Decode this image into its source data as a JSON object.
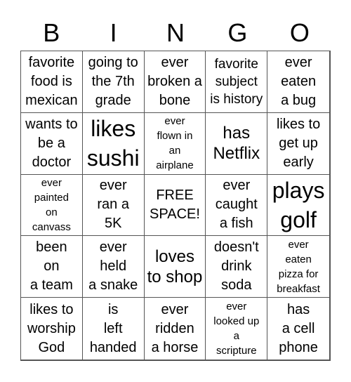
{
  "header": {
    "letters": [
      "B",
      "I",
      "N",
      "G",
      "O"
    ]
  },
  "cells": [
    {
      "text": "favorite\nfood is\nmexican",
      "size": "m"
    },
    {
      "text": "going to\nthe 7th\ngrade",
      "size": "m"
    },
    {
      "text": "ever\nbroken a\nbone",
      "size": "m"
    },
    {
      "text": "favorite\nsubject\nis history",
      "size": "ms"
    },
    {
      "text": "ever\neaten\na bug",
      "size": "m"
    },
    {
      "text": "wants to\nbe a\ndoctor",
      "size": "m"
    },
    {
      "text": "likes\nsushi",
      "size": "xl"
    },
    {
      "text": "ever\nflown in\nan\nairplane",
      "size": "s"
    },
    {
      "text": "has\nNetflix",
      "size": "l"
    },
    {
      "text": "likes to\nget up\nearly",
      "size": "m"
    },
    {
      "text": "ever\npainted\non\ncanvass",
      "size": "s"
    },
    {
      "text": "ever\nran a\n5K",
      "size": "m"
    },
    {
      "text": "FREE\nSPACE!",
      "size": "m",
      "free": true
    },
    {
      "text": "ever\ncaught\na fish",
      "size": "m"
    },
    {
      "text": "plays\ngolf",
      "size": "xl"
    },
    {
      "text": "been\non\na team",
      "size": "m"
    },
    {
      "text": "ever\nheld\na snake",
      "size": "m"
    },
    {
      "text": "loves\nto shop",
      "size": "l"
    },
    {
      "text": "doesn't\ndrink\nsoda",
      "size": "m"
    },
    {
      "text": "ever\neaten\npizza for\nbreakfast",
      "size": "s"
    },
    {
      "text": "likes to\nworship\nGod",
      "size": "m"
    },
    {
      "text": "is\nleft\nhanded",
      "size": "m"
    },
    {
      "text": "ever\nridden\na horse",
      "size": "m"
    },
    {
      "text": "ever\nlooked up\na\nscripture",
      "size": "s"
    },
    {
      "text": "has\na cell\nphone",
      "size": "m"
    }
  ]
}
